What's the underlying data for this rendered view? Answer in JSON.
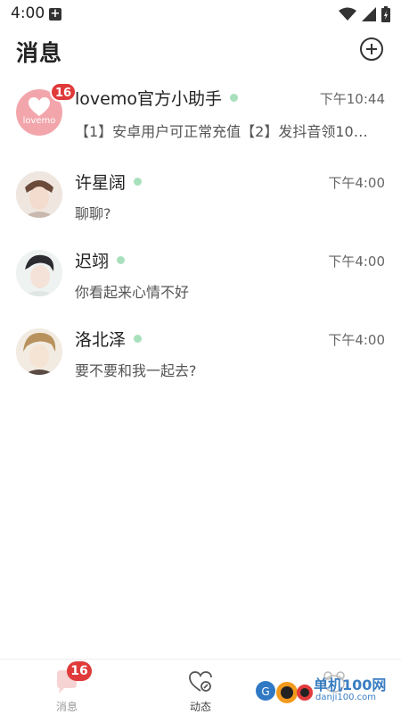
{
  "status_bar": {
    "time": "4:00"
  },
  "header": {
    "title": "消息"
  },
  "chats": [
    {
      "name": "lovemo官方小助手",
      "time": "下午10:44",
      "preview": "【1】安卓用户可正常充值【2】发抖音领10…",
      "unread": "16",
      "avatar_text": "lovemo"
    },
    {
      "name": "许星阔",
      "time": "下午4:00",
      "preview": "聊聊?"
    },
    {
      "name": "迟翊",
      "time": "下午4:00",
      "preview": "你看起来心情不好"
    },
    {
      "name": "洛北泽",
      "time": "下午4:00",
      "preview": "要不要和我一起去?"
    }
  ],
  "nav": {
    "items": [
      {
        "label": "消息",
        "badge": "16"
      },
      {
        "label": "动态"
      }
    ]
  },
  "watermark": {
    "line1": "单机100网",
    "line2": "danji100.com"
  },
  "colors": {
    "badge": "#e03a3a",
    "online": "#a8e0bd",
    "brand_pink": "#f2a6ab"
  }
}
